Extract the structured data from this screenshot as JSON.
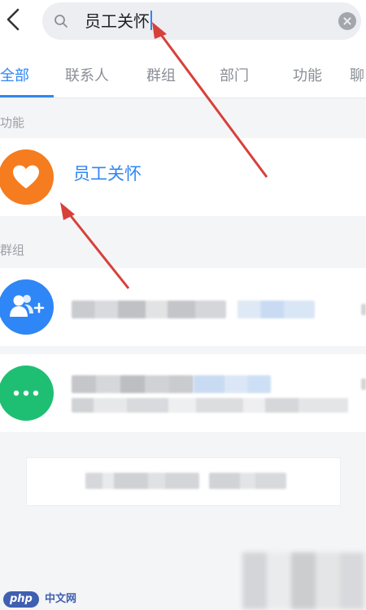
{
  "search": {
    "query": "员工关怀"
  },
  "tabs": [
    {
      "label": "全部"
    },
    {
      "label": "联系人"
    },
    {
      "label": "群组"
    },
    {
      "label": "部门"
    },
    {
      "label": "功能"
    },
    {
      "label": "聊"
    }
  ],
  "sections": {
    "function_label": "功能",
    "group_label": "群组"
  },
  "function_result": {
    "title": "员工关怀",
    "icon": "heart-icon",
    "icon_color": "#f57c1f"
  },
  "group_results": [
    {
      "icon": "group-add-icon",
      "icon_color": "#2f86f6"
    },
    {
      "icon": "more-dots-icon",
      "icon_color": "#1fbf73"
    }
  ],
  "watermark": {
    "badge": "php",
    "text": "中文网"
  },
  "colors": {
    "accent": "#2f86f6",
    "arrow": "#d8403a"
  }
}
